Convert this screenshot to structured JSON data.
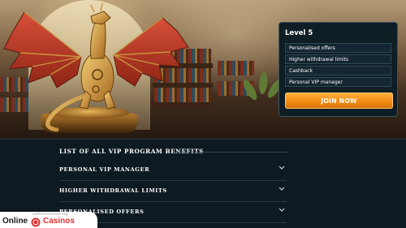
{
  "level_card": {
    "title": "Level 5",
    "perks": [
      "Personalised offers",
      "Higher withdrawal limits",
      "Cashback",
      "Personal VIP manager"
    ],
    "join_label": "JOIN NOW"
  },
  "benefits": {
    "title": "LIST OF ALL VIP PROGRAM BENEFITS",
    "items": [
      "PERSONAL VIP MANAGER",
      "HIGHER WITHDRAWAL LIMITS",
      "PERSONALISED OFFERS"
    ]
  },
  "watermark": {
    "small_text": "authorsinterest.org",
    "online": "Online",
    "casinos": "Casinos"
  },
  "colors": {
    "accent": "#f28a12",
    "background": "#0d1a21",
    "brand_red": "#e0312f"
  },
  "icons": [
    "chevron-down-icon",
    "dragon-statue-illustration",
    "casino-chip-logo"
  ]
}
